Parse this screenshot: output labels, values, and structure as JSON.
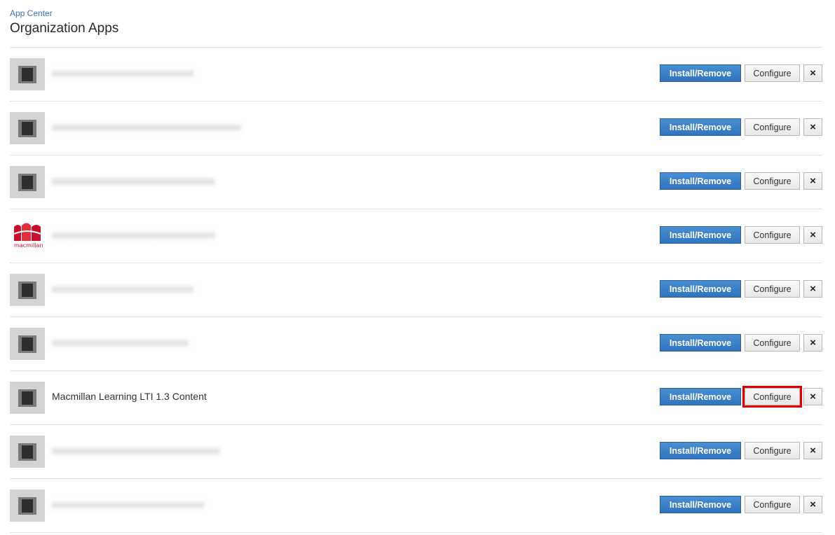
{
  "breadcrumb": "App Center",
  "title": "Organization Apps",
  "buttons": {
    "install": "Install/Remove",
    "configure": "Configure",
    "delete": "×"
  },
  "colors": {
    "primary": "#2f74bd",
    "highlight": "#e00000",
    "brand_red": "#c8102e"
  },
  "apps": [
    {
      "name": "xxxxxxxxxxxxxxxxxxxxxxxxxxx",
      "icon": "generic-app-icon",
      "blurred": true
    },
    {
      "name": "xxxxxxxxxxxxxxxxxxxxxxxxxxxxxxxxxxxx",
      "icon": "generic-app-icon",
      "blurred": true
    },
    {
      "name": "xxxxxxxxxxxxxxxxxxxxxxxxxxxxxxx",
      "icon": "generic-app-icon",
      "blurred": true
    },
    {
      "name": "xxxxxxxxxxxxxxxxxxxxxxxxxxxxxxx",
      "icon": "macmillan-logo",
      "blurred": true,
      "brand": "macmillan"
    },
    {
      "name": "xxxxxxxxxxxxxxxxxxxxxxxxxxx",
      "icon": "generic-app-icon",
      "blurred": true
    },
    {
      "name": "xxxxxxxxxxxxxxxxxxxxxxxxxx",
      "icon": "generic-app-icon",
      "blurred": true
    },
    {
      "name": "Macmillan Learning LTI 1.3 Content",
      "icon": "generic-app-icon",
      "blurred": false,
      "configure_highlighted": true
    },
    {
      "name": "xxxxxxxxxxxxxxxxxxxxxxxxxxxxxxxx",
      "icon": "generic-app-icon",
      "blurred": true
    },
    {
      "name": "xxxxxxxxxxxxxxxxxxxxxxxxxxxxx",
      "icon": "generic-app-icon",
      "blurred": true
    }
  ]
}
